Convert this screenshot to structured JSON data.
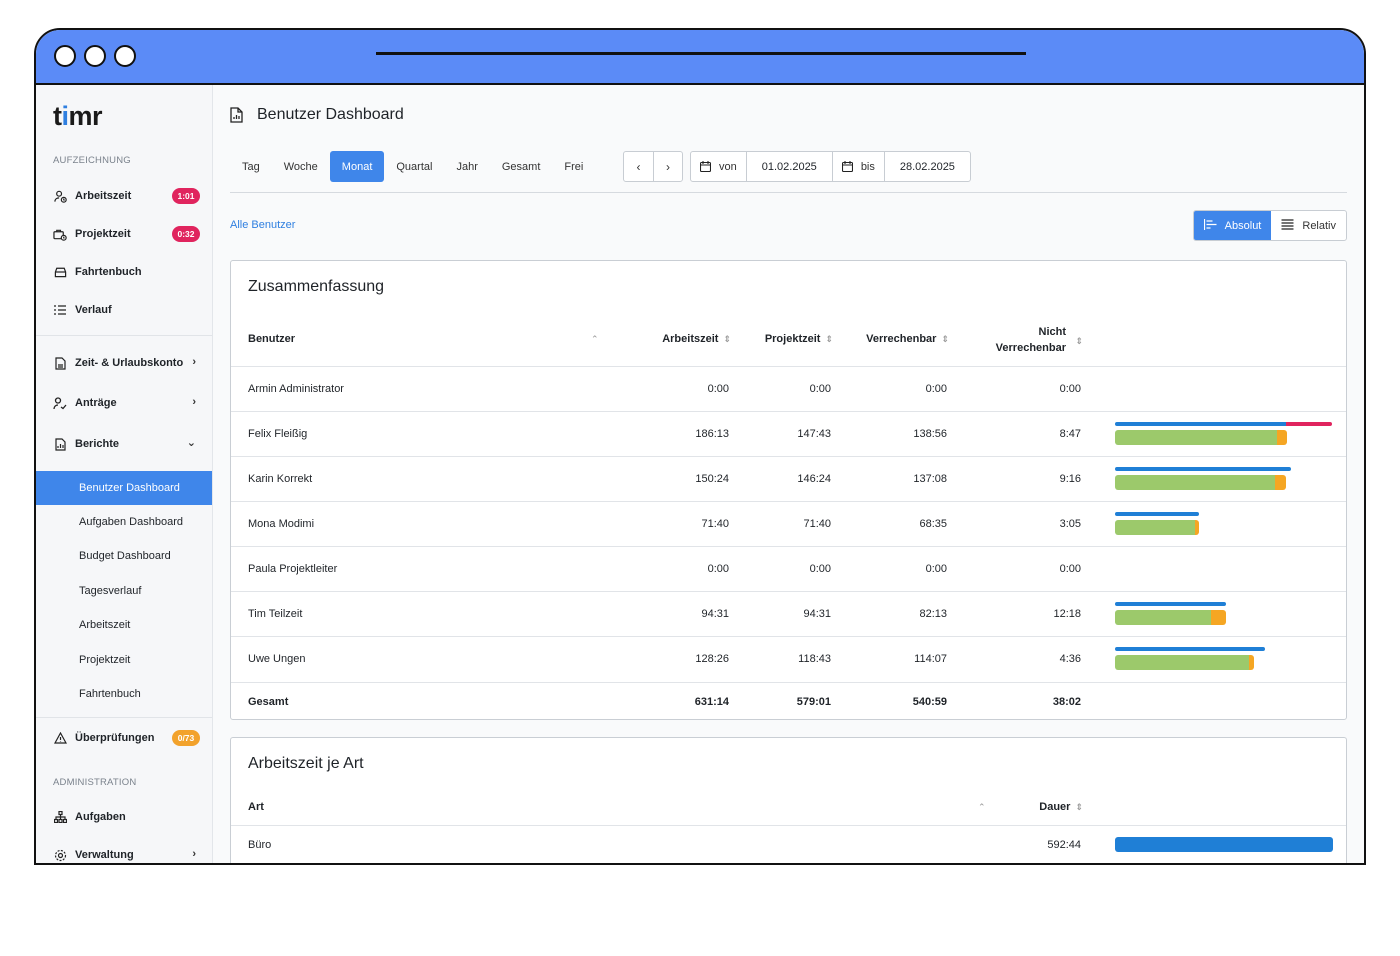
{
  "colors": {
    "titlebar": "#5b8bf7",
    "accent": "#3f86ea",
    "badge_red": "#e0245e",
    "badge_orange": "#f2a22c",
    "bar_blue": "#1f7fd6",
    "bar_red": "#e0245e",
    "bar_green": "#9cc96b",
    "bar_orange": "#f5a623"
  },
  "sidebar": {
    "logo": {
      "pre": "t",
      "dot": "i",
      "post": "mr"
    },
    "section_recording": "AUFZEICHNUNG",
    "items": [
      {
        "label": "Arbeitszeit",
        "icon": "user-clock-icon",
        "badge": "1:01"
      },
      {
        "label": "Projektzeit",
        "icon": "briefcase-clock-icon",
        "badge": "0:32"
      },
      {
        "label": "Fahrtenbuch",
        "icon": "car-icon"
      },
      {
        "label": "Verlauf",
        "icon": "list-icon"
      }
    ],
    "groups": [
      {
        "label": "Zeit- & Urlaubskonto",
        "icon": "document-icon"
      },
      {
        "label": "Anträge",
        "icon": "user-request-icon"
      },
      {
        "label": "Berichte",
        "icon": "report-icon"
      }
    ],
    "reports": [
      "Benutzer Dashboard",
      "Aufgaben Dashboard",
      "Budget Dashboard",
      "Tagesverlauf",
      "Arbeitszeit",
      "Projektzeit",
      "Fahrtenbuch"
    ],
    "review": {
      "label": "Überprüfungen",
      "badge": "0/73"
    },
    "section_admin": "ADMINISTRATION",
    "admin": [
      {
        "label": "Aufgaben",
        "icon": "hierarchy-icon"
      },
      {
        "label": "Verwaltung",
        "icon": "gear-icon"
      }
    ]
  },
  "header": {
    "title": "Benutzer Dashboard"
  },
  "period_tabs": [
    "Tag",
    "Woche",
    "Monat",
    "Quartal",
    "Jahr",
    "Gesamt",
    "Frei"
  ],
  "daterange": {
    "from_label": "von",
    "from": "01.02.2025",
    "to_label": "bis",
    "to": "28.02.2025"
  },
  "users_link": "Alle Benutzer",
  "view_toggle": {
    "absolute": "Absolut",
    "relative": "Relativ"
  },
  "summary": {
    "title": "Zusammenfassung",
    "columns": {
      "user": "Benutzer",
      "work": "Arbeitszeit",
      "project": "Projektzeit",
      "billable": "Verrechenbar",
      "nonbillable_1": "Nicht",
      "nonbillable_2": "Verrechenbar"
    },
    "rows": [
      {
        "user": "Armin Administrator",
        "work": "0:00",
        "project": "0:00",
        "billable": "0:00",
        "nonbillable": "0:00",
        "bar": null
      },
      {
        "user": "Felix Fleißig",
        "work": "186:13",
        "project": "147:43",
        "billable": "138:56",
        "nonbillable": "8:47",
        "bar": {
          "blue": 0.785,
          "red": 0.995,
          "green": 0.743,
          "orange": 0.79
        }
      },
      {
        "user": "Karin Korrekt",
        "work": "150:24",
        "project": "146:24",
        "billable": "137:08",
        "nonbillable": "9:16",
        "bar": {
          "blue": 0.808,
          "red": 0.808,
          "green": 0.736,
          "orange": 0.786
        }
      },
      {
        "user": "Mona Modimi",
        "work": "71:40",
        "project": "71:40",
        "billable": "68:35",
        "nonbillable": "3:05",
        "bar": {
          "blue": 0.385,
          "red": 0.385,
          "green": 0.368,
          "orange": 0.385
        }
      },
      {
        "user": "Paula Projektleiter",
        "work": "0:00",
        "project": "0:00",
        "billable": "0:00",
        "nonbillable": "0:00",
        "bar": null
      },
      {
        "user": "Tim Teilzeit",
        "work": "94:31",
        "project": "94:31",
        "billable": "82:13",
        "nonbillable": "12:18",
        "bar": {
          "blue": 0.508,
          "red": 0.508,
          "green": 0.442,
          "orange": 0.508
        }
      },
      {
        "user": "Uwe Ungen",
        "work": "128:26",
        "project": "118:43",
        "billable": "114:07",
        "nonbillable": "4:36",
        "bar": {
          "blue": 0.69,
          "red": 0.69,
          "green": 0.613,
          "orange": 0.638
        }
      }
    ],
    "total": {
      "label": "Gesamt",
      "work": "631:14",
      "project": "579:01",
      "billable": "540:59",
      "nonbillable": "38:02"
    }
  },
  "by_type": {
    "title": "Arbeitszeit je Art",
    "columns": {
      "type": "Art",
      "duration": "Dauer"
    },
    "rows": [
      {
        "type": "Büro",
        "duration": "592:44",
        "bar": 1.0
      }
    ]
  }
}
